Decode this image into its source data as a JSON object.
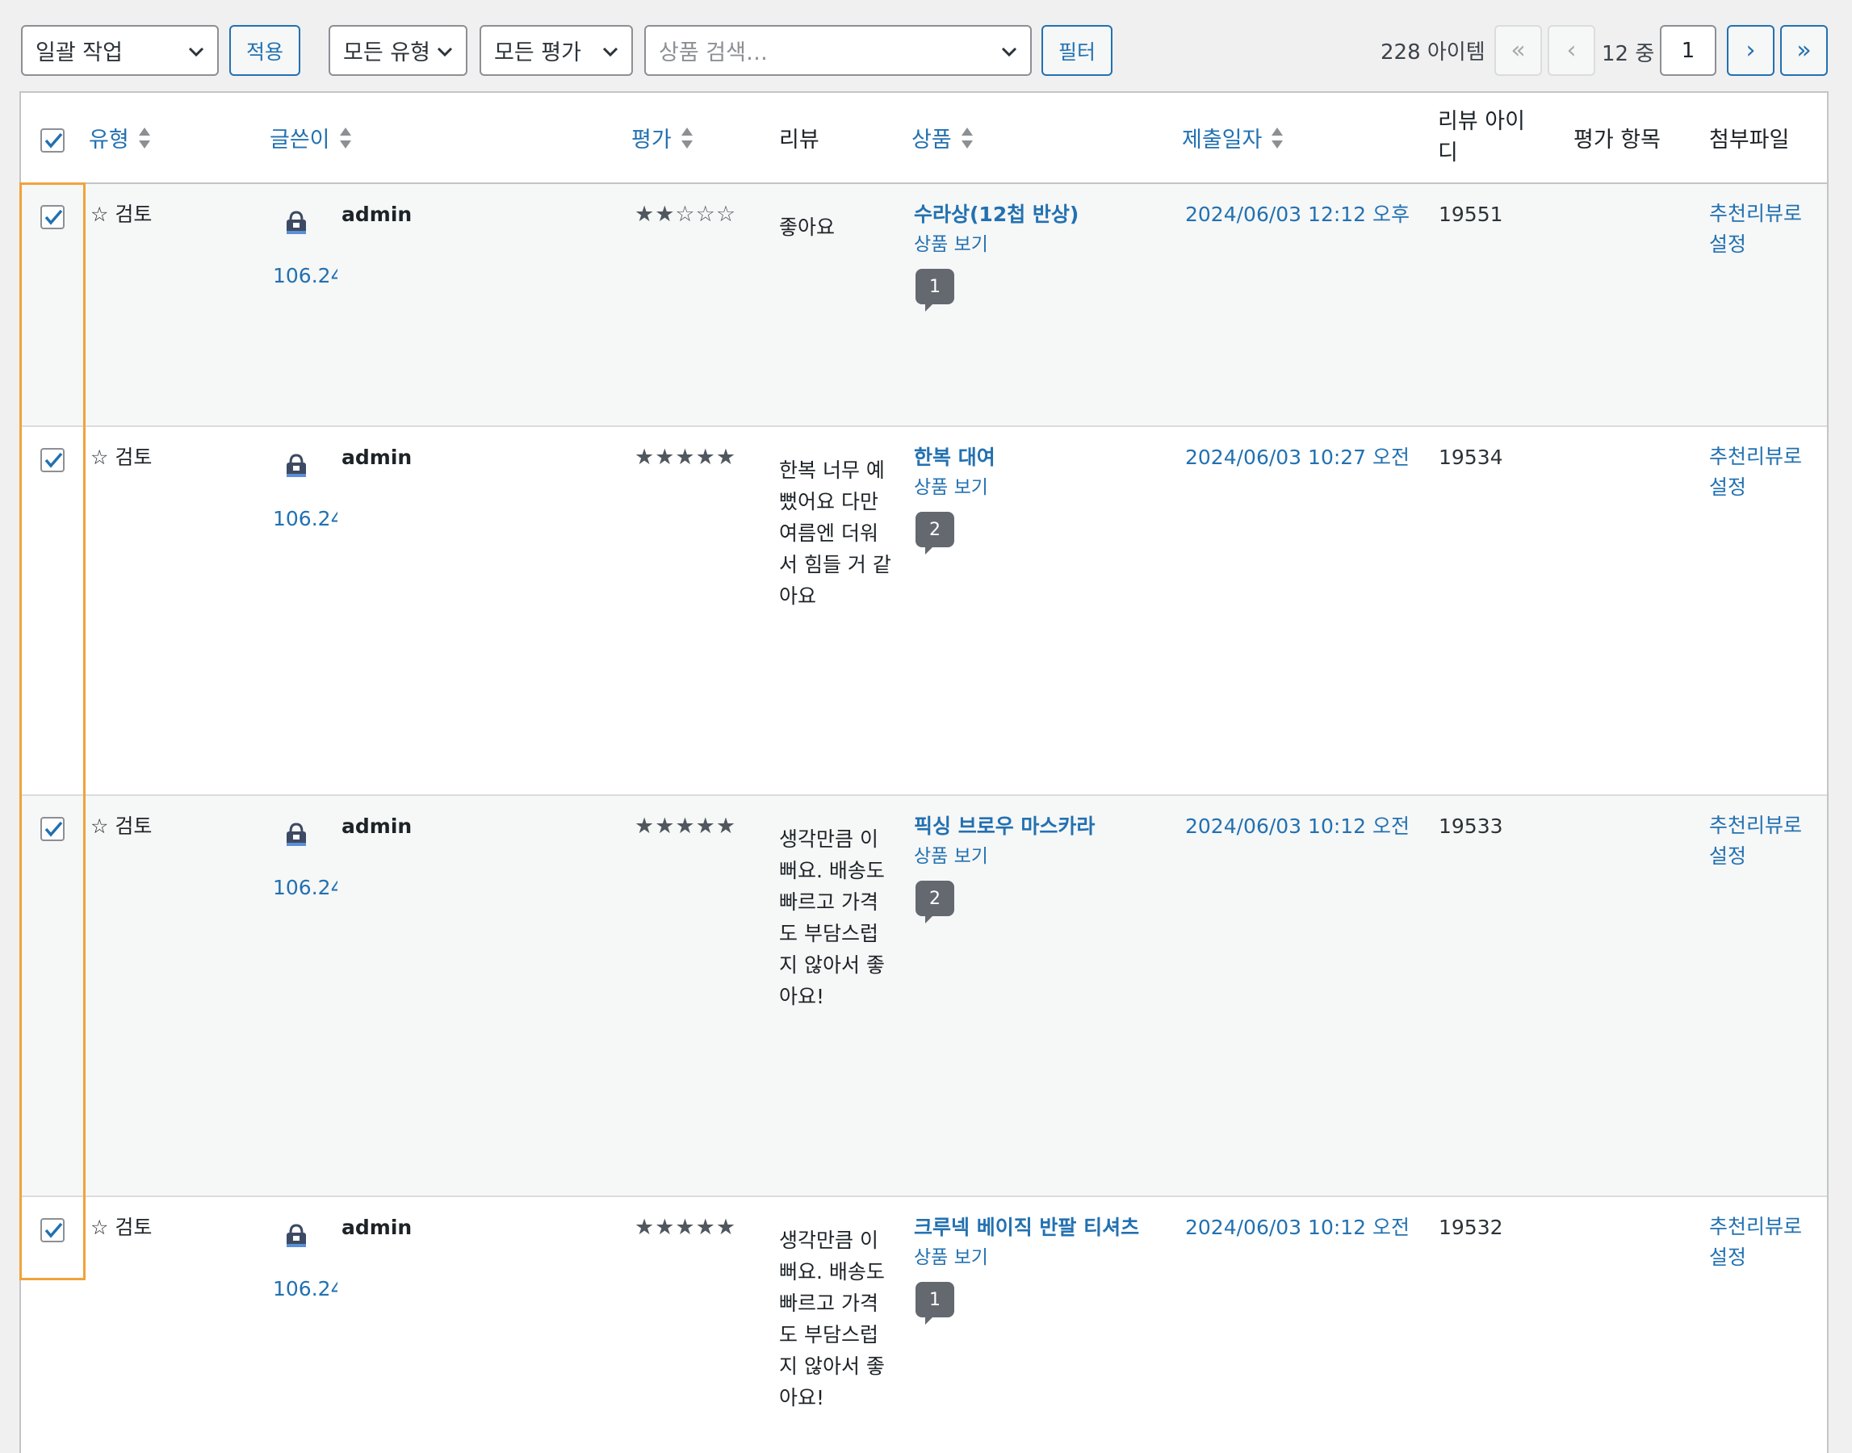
{
  "toolbar": {
    "bulk_action": "일괄 작업",
    "apply_label": "적용",
    "type_filter": "모든 유형",
    "rating_filter": "모든 평가",
    "product_search_placeholder": "상품 검색…",
    "filter_label": "필터",
    "item_count": "228 아이템",
    "page_first": "«",
    "page_prev": "‹",
    "total_pages": "12",
    "page_of": "중",
    "current_page": "1",
    "page_next": "›",
    "page_last": "»"
  },
  "columns": {
    "type": "유형",
    "author": "글쓴이",
    "rating": "평가",
    "review": "리뷰",
    "product": "상품",
    "submitted": "제출일자",
    "review_id_line1": "리뷰 아이",
    "review_id_line2": "디",
    "rating_items": "평가 항목",
    "attachment": "첨부파일"
  },
  "rows": [
    {
      "type": "☆ 검토",
      "author": "admin",
      "ip": "106.24",
      "stars": "★★☆☆☆",
      "review": "좋아요",
      "product": "수라상(12첩 반상)",
      "view": "상품 보기",
      "count": "1",
      "date": "2024/06/03 12:12 오후",
      "id": "19551",
      "attach1": "추천리뷰로",
      "attach2": "설정"
    },
    {
      "type": "☆ 검토",
      "author": "admin",
      "ip": "106.24",
      "stars": "★★★★★",
      "review": "한복 너무 예뻤어요 다만 여름엔 더워서 힘들 거 같아요",
      "product": "한복 대여",
      "view": "상품 보기",
      "count": "2",
      "date": "2024/06/03 10:27 오전",
      "id": "19534",
      "attach1": "추천리뷰로",
      "attach2": "설정"
    },
    {
      "type": "☆ 검토",
      "author": "admin",
      "ip": "106.24",
      "stars": "★★★★★",
      "review": "생각만큼 이뻐요. 배송도 빠르고 가격도 부담스럽지 않아서 좋아요!",
      "product": "픽싱 브로우 마스카라",
      "view": "상품 보기",
      "count": "2",
      "date": "2024/06/03 10:12 오전",
      "id": "19533",
      "attach1": "추천리뷰로",
      "attach2": "설정"
    },
    {
      "type": "☆ 검토",
      "author": "admin",
      "ip": "106.24",
      "stars": "★★★★★",
      "review": "생각만큼 이뻐요. 배송도 빠르고 가격도 부담스럽지 않아서 좋아요!",
      "product": "크루넥 베이직 반팔 티셔츠",
      "view": "상품 보기",
      "count": "1",
      "date": "2024/06/03 10:12 오전",
      "id": "19532",
      "attach1": "추천리뷰로",
      "attach2": "설정"
    }
  ]
}
